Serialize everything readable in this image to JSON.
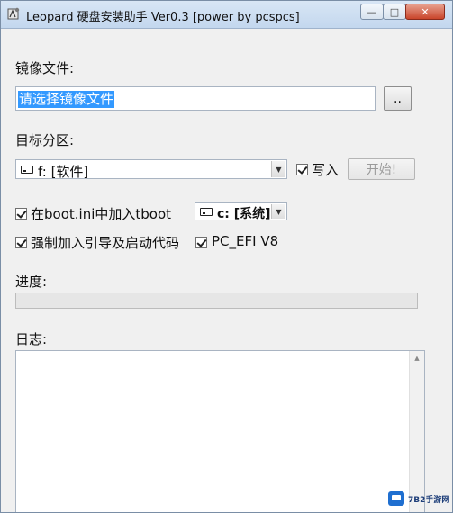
{
  "window": {
    "title": "Leopard 硬盘安装助手 Ver0.3 [power by pcspcs]",
    "controls": {
      "minimize": "—",
      "maximize": "□",
      "close": "✕"
    }
  },
  "image_file": {
    "label": "镜像文件:",
    "value": "请选择镜像文件",
    "browse_label": ".."
  },
  "target_partition": {
    "label": "目标分区:",
    "selected": "f: [软件]",
    "write_checkbox": {
      "label": "写入",
      "checked": true
    },
    "start_button": "开始!"
  },
  "boot_options": {
    "bootini": {
      "label": "在boot.ini中加入tboot",
      "checked": true
    },
    "boot_drive": "c: [系统]",
    "force_boot": {
      "label": "强制加入引导及启动代码",
      "checked": true
    },
    "pc_efi": {
      "label": "PC_EFI V8",
      "checked": true
    }
  },
  "progress": {
    "label": "进度:",
    "value": 0
  },
  "log": {
    "label": "日志:"
  },
  "watermark": {
    "text": "7B2手游网"
  }
}
